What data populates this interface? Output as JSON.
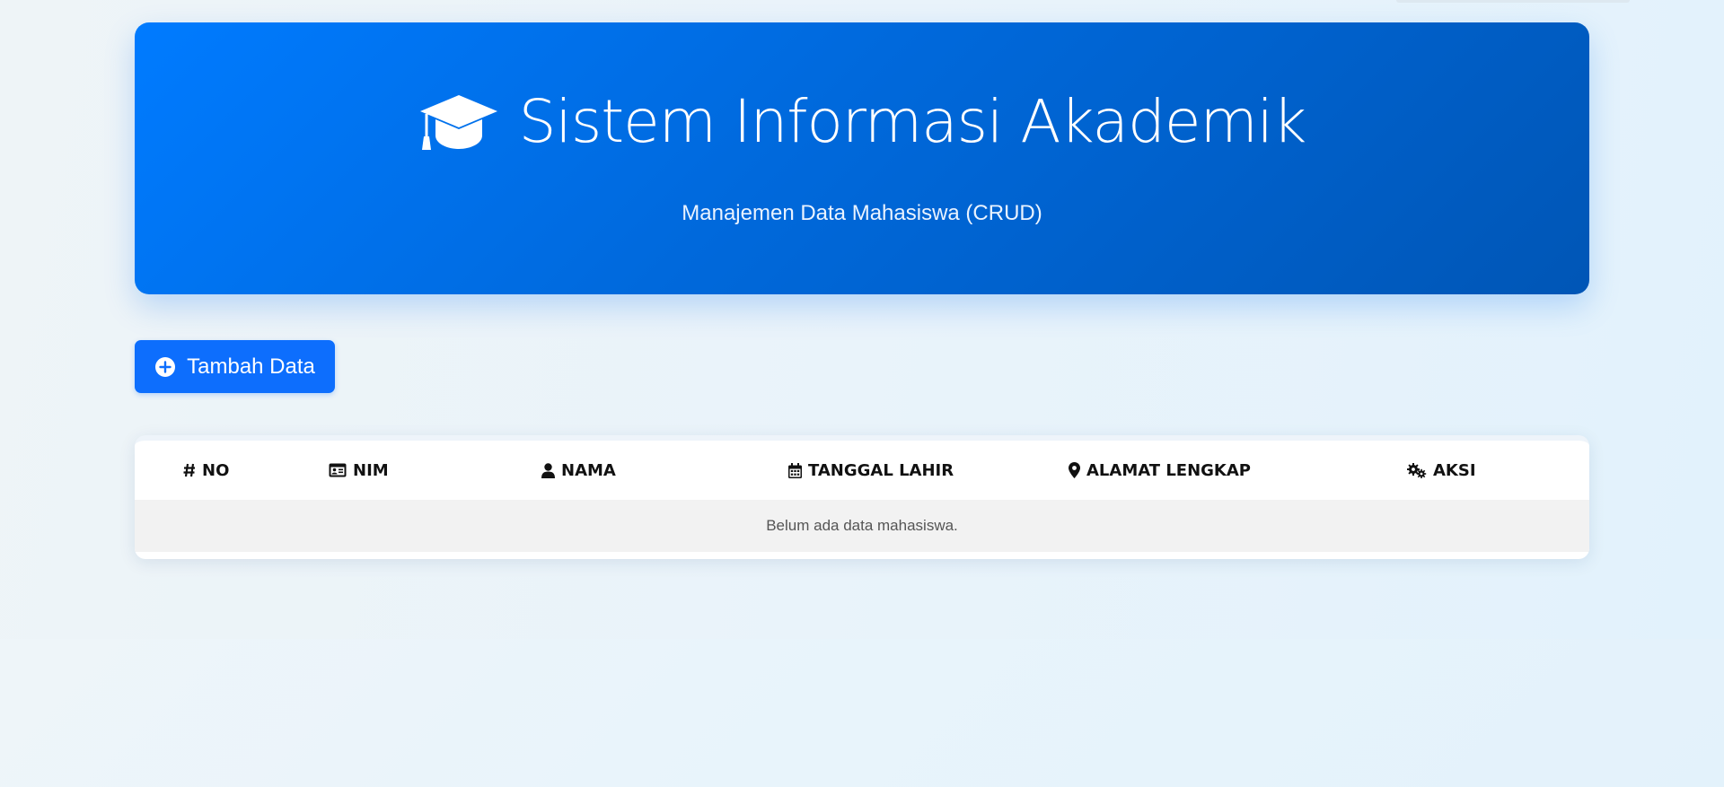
{
  "header": {
    "title": "Sistem Informasi Akademik",
    "subtitle": "Manajemen Data Mahasiswa (CRUD)",
    "icon": "graduation-cap-icon"
  },
  "actions": {
    "add_label": "Tambah Data",
    "add_icon": "plus-circle-icon"
  },
  "table": {
    "columns": [
      {
        "label": "NO",
        "icon": "hash-icon"
      },
      {
        "label": "NIM",
        "icon": "id-card-icon"
      },
      {
        "label": "NAMA",
        "icon": "user-icon"
      },
      {
        "label": "TANGGAL LAHIR",
        "icon": "calendar-icon"
      },
      {
        "label": "ALAMAT LENGKAP",
        "icon": "map-marker-icon"
      },
      {
        "label": "AKSI",
        "icon": "cogs-icon"
      }
    ],
    "rows": [],
    "empty_message": "Belum ada data mahasiswa."
  },
  "colors": {
    "primary": "#007bff",
    "primary_dark": "#0056b6",
    "button": "#0d6efd",
    "empty_row_bg": "#f2f2f2"
  }
}
